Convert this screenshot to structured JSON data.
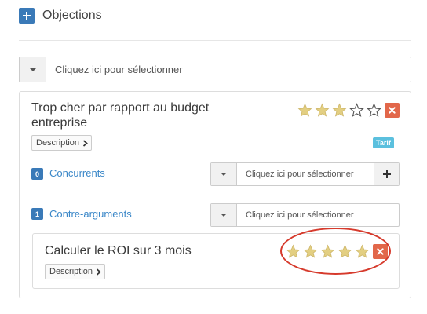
{
  "section": {
    "title": "Objections"
  },
  "main_select": {
    "placeholder": "Cliquez ici pour sélectionner"
  },
  "objection": {
    "title_line1": "Trop cher par rapport au budget",
    "title_line2": "entreprise",
    "description_label": "Description",
    "tag": "Tarif",
    "rating": 3,
    "rating_max": 5,
    "concurrents": {
      "count": "0",
      "label": "Concurrents",
      "placeholder": "Cliquez ici pour sélectionner"
    },
    "contre_arguments": {
      "count": "1",
      "label": "Contre-arguments",
      "placeholder": "Cliquez ici pour sélectionner"
    }
  },
  "counter_argument": {
    "title": "Calculer le ROI sur 3 mois",
    "description_label": "Description",
    "rating": 5,
    "rating_max": 5
  },
  "colors": {
    "accent_blue": "#3a7ab8",
    "star_filled": "#e3cf82",
    "delete_red": "#e2674a",
    "tag_blue": "#5bc0de",
    "highlight_ellipse": "#d63a2c"
  },
  "icons": [
    "plus-icon",
    "caret-down-icon",
    "star-icon",
    "close-icon",
    "chevron-right-icon"
  ]
}
